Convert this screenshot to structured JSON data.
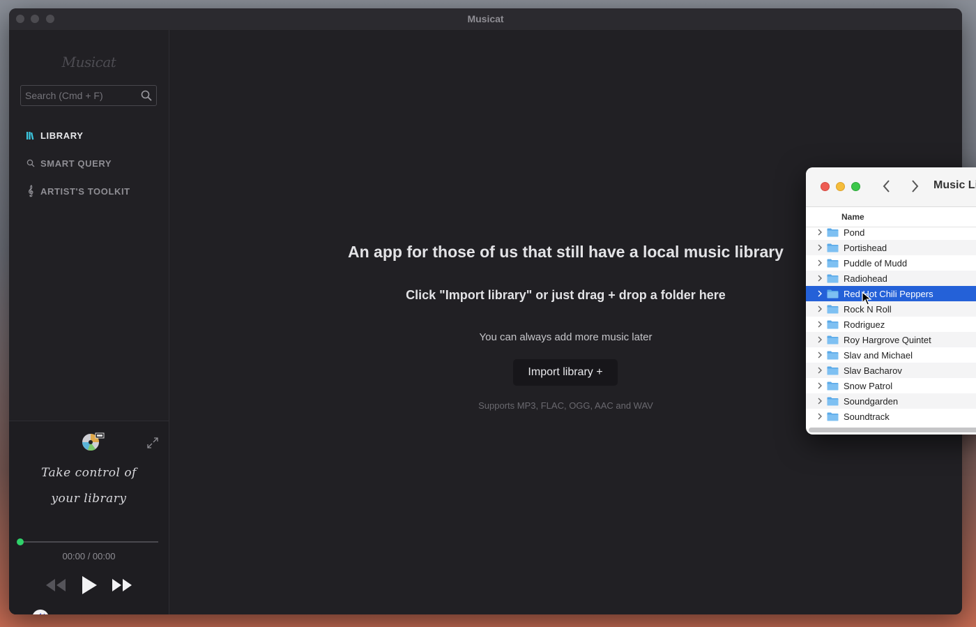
{
  "window": {
    "title": "Musicat"
  },
  "sidebar": {
    "logo": "Musicat",
    "search": {
      "placeholder": "Search (Cmd + F)",
      "value": ""
    },
    "nav": [
      {
        "label": "LIBRARY",
        "icon": "library-icon",
        "active": true
      },
      {
        "label": "SMART QUERY",
        "icon": "search-icon",
        "active": false
      },
      {
        "label": "ARTIST'S TOOLKIT",
        "icon": "treble-clef-icon",
        "active": false
      }
    ]
  },
  "player": {
    "tagline_line1": "Take control of",
    "tagline_line2": "your library",
    "time": "00:00 / 00:00",
    "progress": 0,
    "volume_icon": "speaker-icon"
  },
  "main": {
    "headline": "An app for those of us that still have a local music library",
    "subheadline": "Click \"Import library\" or just drag + drop a folder here",
    "note": "You can always add more music later",
    "import_button": "Import library +",
    "supports": "Supports MP3, FLAC, OGG, AAC and WAV"
  },
  "finder": {
    "title": "Music Li",
    "column_header": "Name",
    "rows": [
      {
        "name": "Pond",
        "selected": false
      },
      {
        "name": "Portishead",
        "selected": false
      },
      {
        "name": "Puddle of Mudd",
        "selected": false
      },
      {
        "name": "Radiohead",
        "selected": false
      },
      {
        "name": "Red Hot Chili Peppers",
        "selected": true
      },
      {
        "name": "Rock N Roll",
        "selected": false
      },
      {
        "name": "Rodriguez",
        "selected": false
      },
      {
        "name": "Roy Hargrove Quintet",
        "selected": false
      },
      {
        "name": "Slav and Michael",
        "selected": false
      },
      {
        "name": "Slav Bacharov",
        "selected": false
      },
      {
        "name": "Snow Patrol",
        "selected": false
      },
      {
        "name": "Soundgarden",
        "selected": false
      },
      {
        "name": "Soundtrack",
        "selected": false
      }
    ]
  },
  "colors": {
    "accent": "#2fd16a",
    "library_icon": "#3cc8e0",
    "selection": "#2461d8"
  }
}
